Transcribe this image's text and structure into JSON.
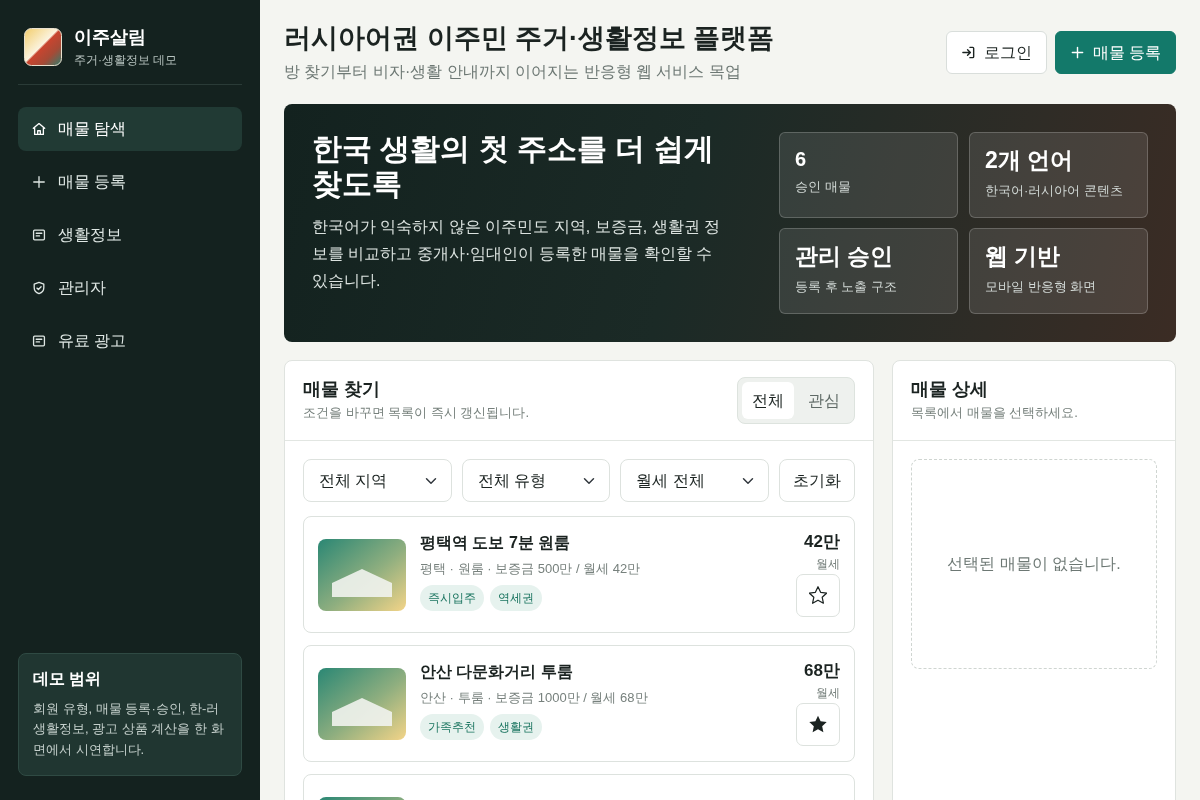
{
  "sidebar": {
    "brand": {
      "name": "이주살림",
      "subtitle": "주거·생활정보 데모"
    },
    "nav": [
      {
        "label": "매물 탐색",
        "selected": true
      },
      {
        "label": "매물 등록",
        "selected": false
      },
      {
        "label": "생활정보",
        "selected": false
      },
      {
        "label": "관리자",
        "selected": false
      },
      {
        "label": "유료 광고",
        "selected": false
      }
    ],
    "demo_note": {
      "title": "데모 범위",
      "text": "회원 유형, 매물 등록·승인, 한-러 생활정보, 광고 상품 계산을 한 화면에서 시연합니다."
    }
  },
  "header": {
    "title": "러시아어권 이주민 주거·생활정보 플랫폼",
    "subtitle": "방 찾기부터 비자·생활 안내까지 이어지는 반응형 웹 서비스 목업",
    "buttons": [
      {
        "label": "로그인",
        "kind": "outline"
      },
      {
        "label": "매물 등록",
        "kind": "primary"
      }
    ]
  },
  "hero": {
    "title": "한국 생활의 첫 주소를 더 쉽게 찾도록",
    "text": "한국어가 익숙하지 않은 이주민도 지역, 보증금, 생활권 정보를 비교하고 중개사·임대인이 등록한 매물을 확인할 수 있습니다.",
    "stats": [
      {
        "value": "6",
        "label": "승인 매물"
      },
      {
        "value": "2개 언어",
        "label": "한국어·러시아어 콘텐츠"
      },
      {
        "value": "관리 승인",
        "label": "등록 후 노출 구조"
      },
      {
        "value": "웹 기반",
        "label": "모바일 반응형 화면"
      }
    ]
  },
  "listing_panel": {
    "title": "매물 찾기",
    "subtitle": "조건을 바꾸면 목록이 즉시 갱신됩니다.",
    "view_tabs": [
      {
        "label": "전체",
        "selected": true
      },
      {
        "label": "관심",
        "selected": false
      }
    ],
    "filters": [
      "전체 지역",
      "전체 유형",
      "월세 전체"
    ],
    "reset_button": "초기화",
    "listings": [
      {
        "title": "평택역 도보 7분 원룸",
        "meta": "평택 · 원룸 · 보증금 500만 / 월세 42만",
        "tags": [
          "즉시입주",
          "역세권"
        ],
        "price": "42만",
        "price_type": "월세",
        "favorite": false
      },
      {
        "title": "안산 다문화거리 투룸",
        "meta": "안산 · 투룸 · 보증금 1000만 / 월세 68만",
        "tags": [
          "가족추천",
          "생활권"
        ],
        "price": "68만",
        "price_type": "월세",
        "favorite": true
      }
    ],
    "more_listings_cut_off": true
  },
  "detail_panel": {
    "title": "매물 상세",
    "subtitle": "목록에서 매물을 선택하세요.",
    "empty_text": "선택된 매물이 없습니다."
  }
}
